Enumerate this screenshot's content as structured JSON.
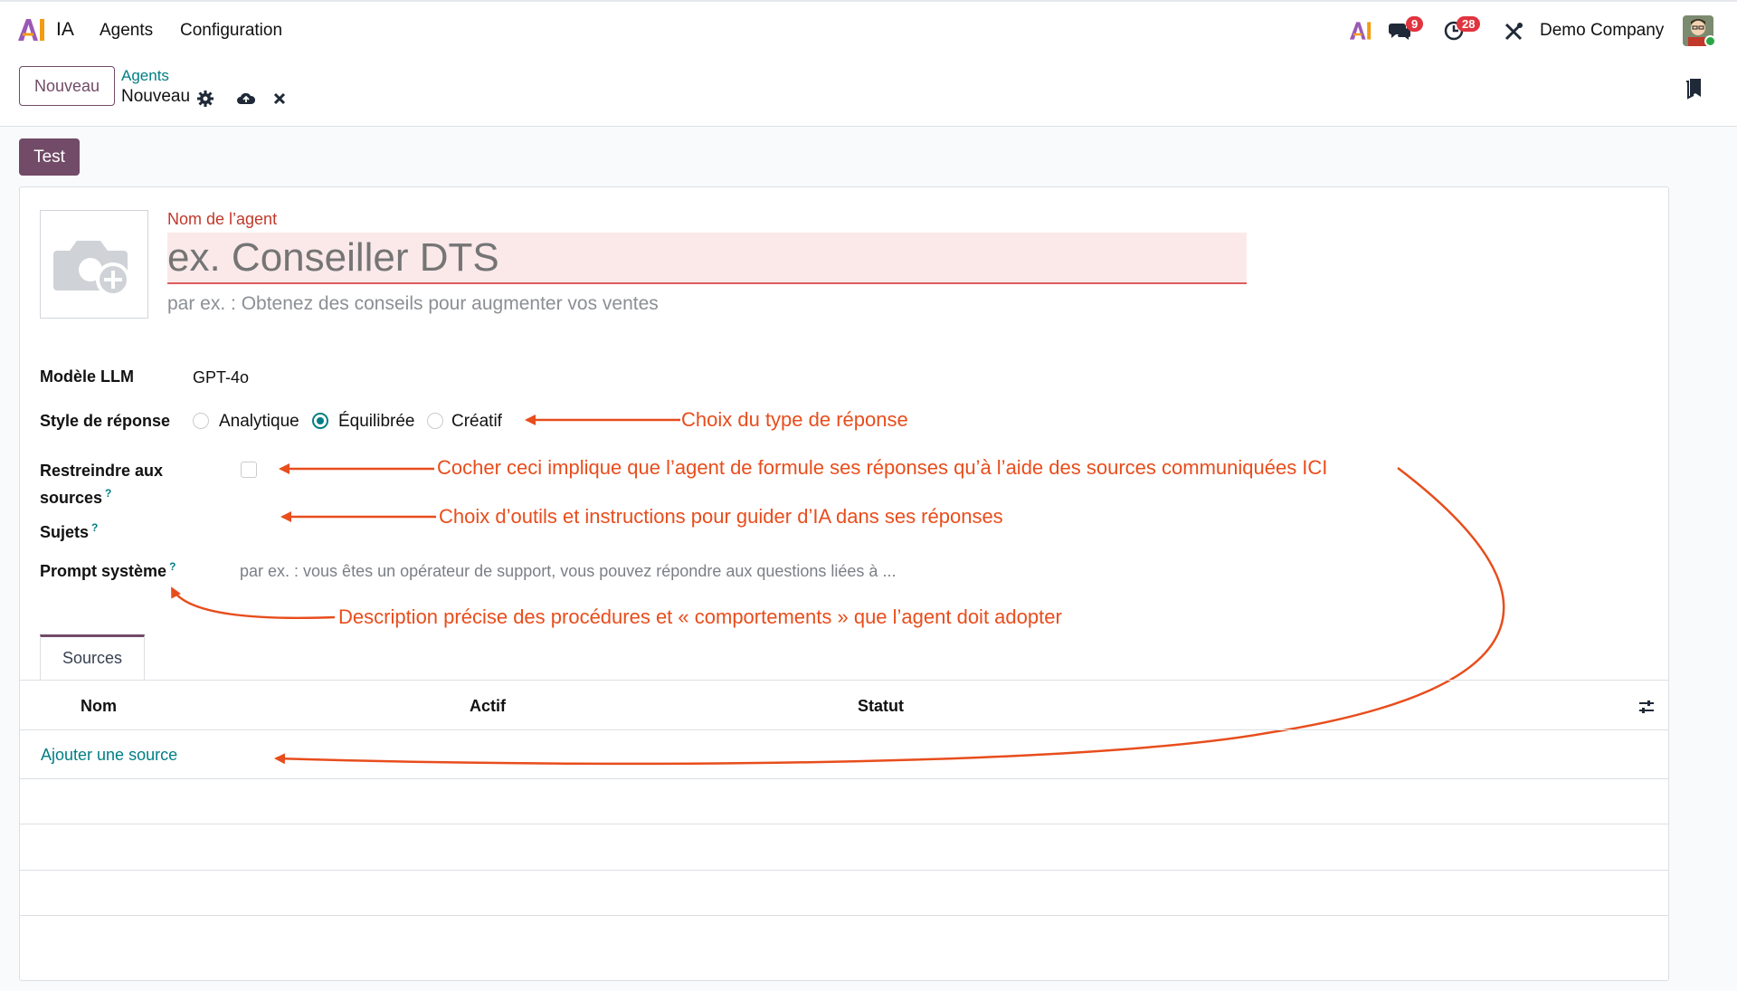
{
  "navbar": {
    "app_name": "IA",
    "menu": [
      "Agents",
      "Configuration"
    ],
    "chat_badge": "9",
    "activity_badge": "28",
    "company": "Demo Company"
  },
  "control": {
    "new_button": "Nouveau",
    "breadcrumb_parent": "Agents",
    "breadcrumb_current": "Nouveau"
  },
  "toolbar": {
    "test_button": "Test"
  },
  "form": {
    "name_label": "Nom de l’agent",
    "name_placeholder": "ex. Conseiller DTS",
    "description_placeholder": "par ex. : Obtenez des conseils pour augmenter vos ventes",
    "llm_label": "Modèle LLM",
    "llm_value": "GPT-4o",
    "style_label": "Style de réponse",
    "style_options": [
      "Analytique",
      "Équilibrée",
      "Créatif"
    ],
    "style_selected": "Équilibrée",
    "restrict_label_1": "Restreindre aux",
    "restrict_label_2": "sources",
    "restrict_checked": false,
    "topics_label": "Sujets",
    "prompt_label": "Prompt système",
    "prompt_placeholder": "par ex. : vous êtes un opérateur de support, vous pouvez répondre aux questions liées à ...",
    "help_mark": "?"
  },
  "annotations": {
    "style": "Choix du type de réponse",
    "restrict": "Cocher ceci  implique que l’agent de formule ses réponses qu’à l’aide des sources communiquées ICI",
    "topics": "Choix d’outils et instructions pour guider d’IA dans ses réponses",
    "prompt": "Description précise des procédures et « comportements » que l’agent doit adopter"
  },
  "sources": {
    "tab": "Sources",
    "columns": [
      "Nom",
      "Actif",
      "Statut"
    ],
    "add_link": "Ajouter une source"
  },
  "colors": {
    "brand": "#714b67",
    "accent": "#017e84",
    "annotation": "#e84d1c"
  }
}
